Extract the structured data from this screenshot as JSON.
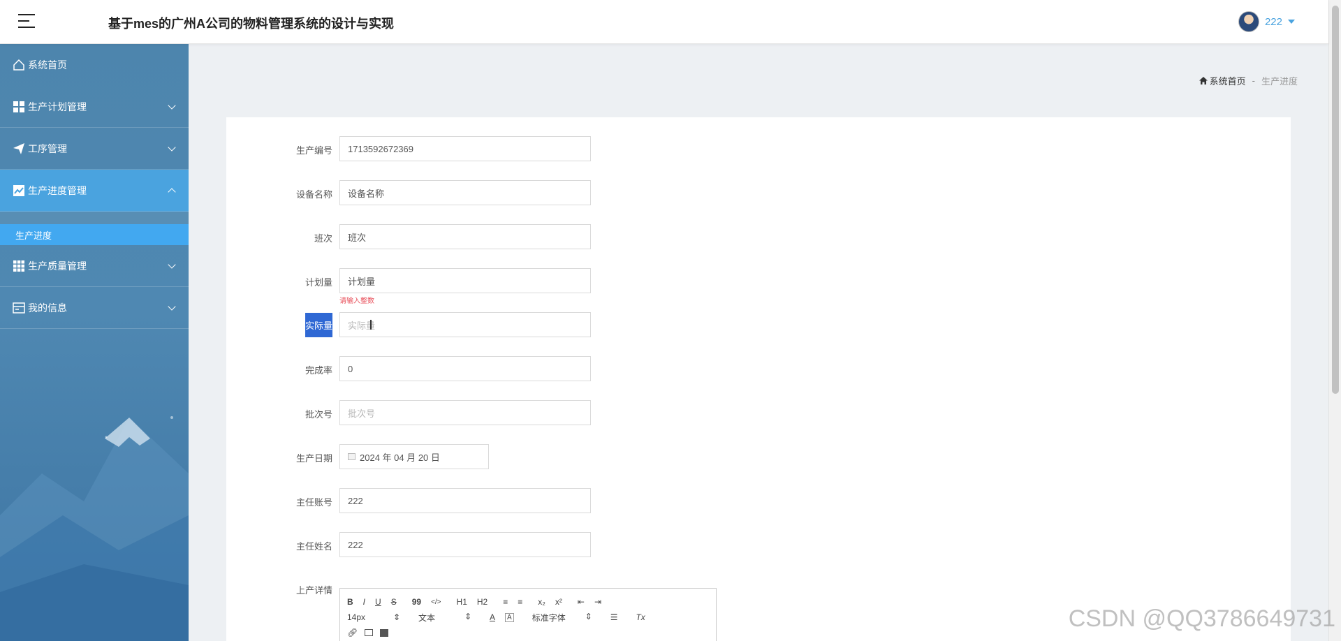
{
  "header": {
    "title": "基于mes的广州A公司的物料管理系统的设计与实现",
    "username": "222"
  },
  "sidebar": {
    "items": [
      {
        "label": "系统首页",
        "icon": "home-icon"
      },
      {
        "label": "生产计划管理",
        "icon": "grid-icon"
      },
      {
        "label": "工序管理",
        "icon": "send-icon"
      },
      {
        "label": "生产进度管理",
        "icon": "chart-icon"
      },
      {
        "label": "生产质量管理",
        "icon": "table-icon"
      },
      {
        "label": "我的信息",
        "icon": "card-icon"
      }
    ],
    "subitem": {
      "label": "生产进度"
    }
  },
  "breadcrumb": {
    "home": "系统首页",
    "separator": "-",
    "current": "生产进度"
  },
  "form": {
    "production_no": {
      "label": "生产编号",
      "value": "1713592672369"
    },
    "device_name": {
      "label": "设备名称",
      "placeholder": "设备名称"
    },
    "shift": {
      "label": "班次",
      "placeholder": "班次"
    },
    "planned_qty": {
      "label": "计划量",
      "placeholder": "计划量",
      "error": "请输入整数"
    },
    "actual_qty": {
      "label": "实际量",
      "placeholder": "实际量"
    },
    "completion_rate": {
      "label": "完成率",
      "value": "0"
    },
    "batch_no": {
      "label": "批次号",
      "placeholder": "批次号"
    },
    "production_date": {
      "label": "生产日期",
      "value": "2024 年 04 月 20 日"
    },
    "supervisor_account": {
      "label": "主任账号",
      "value": "222"
    },
    "supervisor_name": {
      "label": "主任姓名",
      "value": "222"
    },
    "details": {
      "label": "上产详情"
    }
  },
  "editor_toolbar": {
    "row1": [
      "B",
      "I",
      "U",
      "S",
      "99",
      "</>",
      "H1",
      "H2",
      "≡",
      "≡",
      "x₂",
      "x²",
      "⇤",
      "⇥"
    ],
    "font_size": "14px",
    "text_style": "文本",
    "font_family": "标准字体",
    "color_a": "A",
    "bg_a": "A",
    "clear": "Tx"
  },
  "watermark": "CSDN @QQ3786649731",
  "colors": {
    "accent": "#4aa3df",
    "selection": "#2f68d4",
    "error": "#e8505b"
  }
}
